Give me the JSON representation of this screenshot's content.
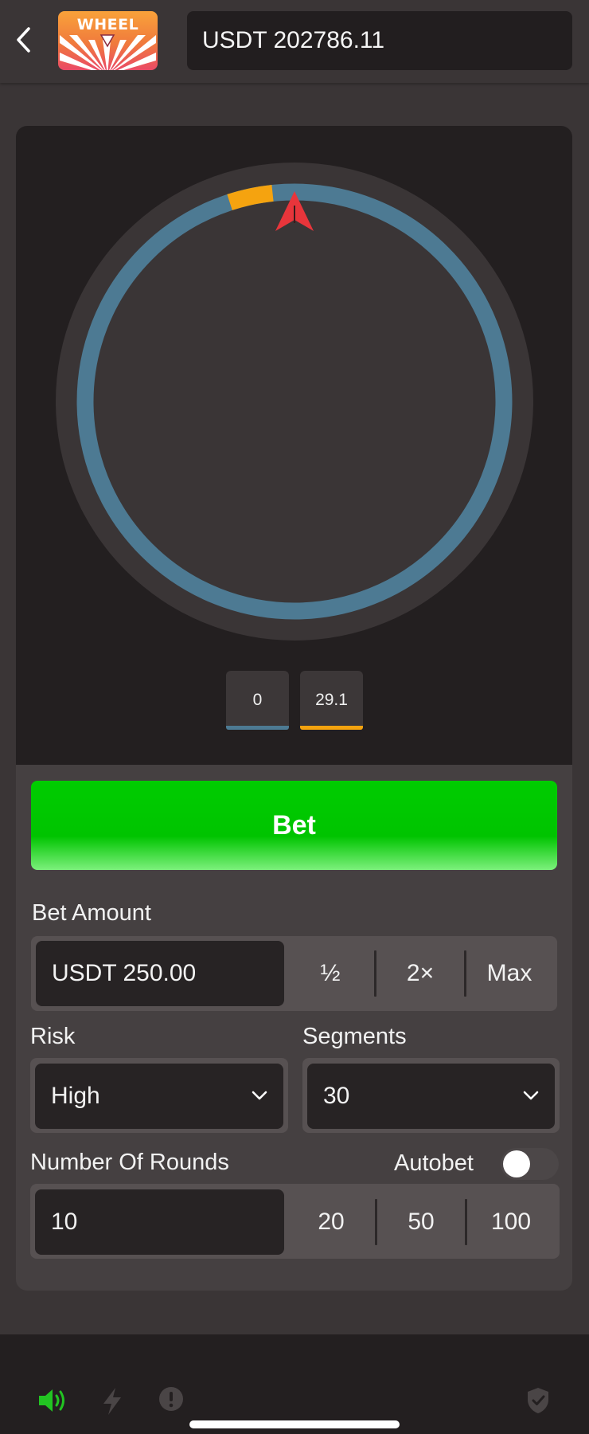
{
  "header": {
    "logo_text": "WHEEL",
    "balance": "USDT 202786.11"
  },
  "wheel": {
    "segments": 30,
    "highlighted_segment_color": "#f5a30f",
    "base_segment_color": "#4d7a93",
    "pointer_color": "#e8353b"
  },
  "payouts": [
    {
      "label": "0",
      "color": "#4d7a93"
    },
    {
      "label": "29.1",
      "color": "#f5a30f"
    }
  ],
  "bet_button": {
    "label": "Bet",
    "color": "#00cc00"
  },
  "bet_amount": {
    "label": "Bet Amount",
    "value": "USDT 250.00",
    "options": [
      "½",
      "2×",
      "Max"
    ]
  },
  "risk": {
    "label": "Risk",
    "value": "High"
  },
  "segments": {
    "label": "Segments",
    "value": "30"
  },
  "rounds": {
    "label": "Number Of Rounds",
    "value": "10",
    "options": [
      "20",
      "50",
      "100"
    ]
  },
  "autobet": {
    "label": "Autobet",
    "enabled": false
  },
  "footer": {
    "icons": [
      "volume-icon",
      "lightning-icon",
      "alert-icon",
      "shield-check-icon"
    ],
    "active_color": "#22c422"
  }
}
